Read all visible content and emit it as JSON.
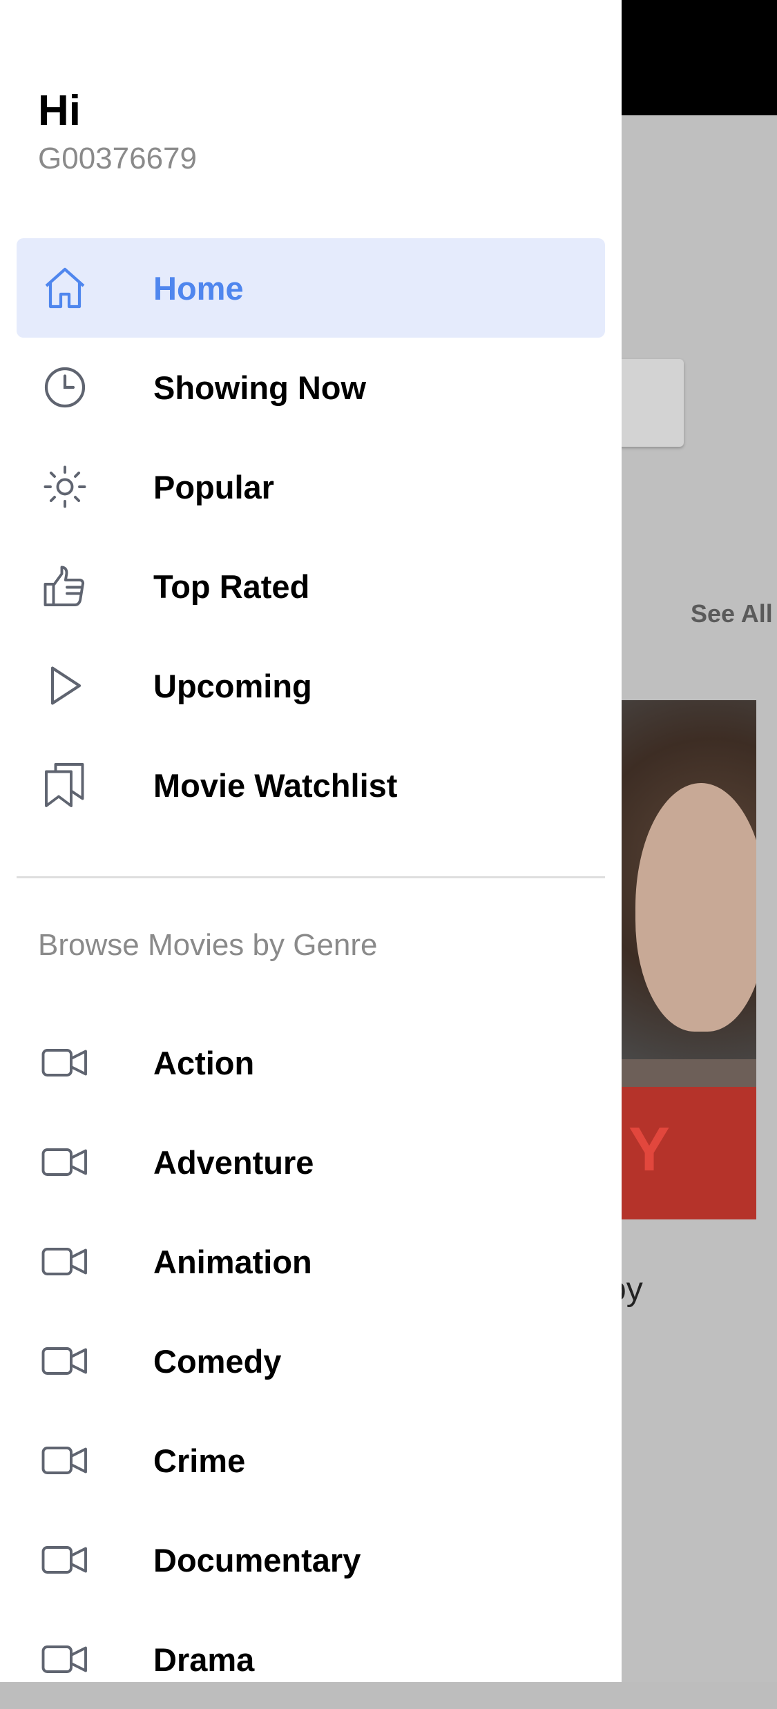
{
  "background": {
    "see_all": "See All",
    "poster_letter": "Y",
    "partial_title": "oy"
  },
  "drawer": {
    "greeting": "Hi",
    "user_id": "G00376679",
    "menu": [
      {
        "label": "Home",
        "icon": "home-icon",
        "active": true
      },
      {
        "label": "Showing Now",
        "icon": "clock-icon"
      },
      {
        "label": "Popular",
        "icon": "sun-icon"
      },
      {
        "label": "Top Rated",
        "icon": "thumbs-up-icon"
      },
      {
        "label": "Upcoming",
        "icon": "play-icon"
      },
      {
        "label": "Movie Watchlist",
        "icon": "bookmarks-icon"
      }
    ],
    "genre_heading": "Browse Movies by Genre",
    "genres": [
      {
        "label": "Action",
        "icon": "video-camera-icon"
      },
      {
        "label": "Adventure",
        "icon": "video-camera-icon"
      },
      {
        "label": "Animation",
        "icon": "video-camera-icon"
      },
      {
        "label": "Comedy",
        "icon": "video-camera-icon"
      },
      {
        "label": "Crime",
        "icon": "video-camera-icon"
      },
      {
        "label": "Documentary",
        "icon": "video-camera-icon"
      },
      {
        "label": "Drama",
        "icon": "video-camera-icon"
      }
    ]
  },
  "colors": {
    "accent": "#4f86ee",
    "active_bg": "#e5ebfc",
    "icon_gray": "#5f6470",
    "muted_text": "#8a8a8a"
  }
}
